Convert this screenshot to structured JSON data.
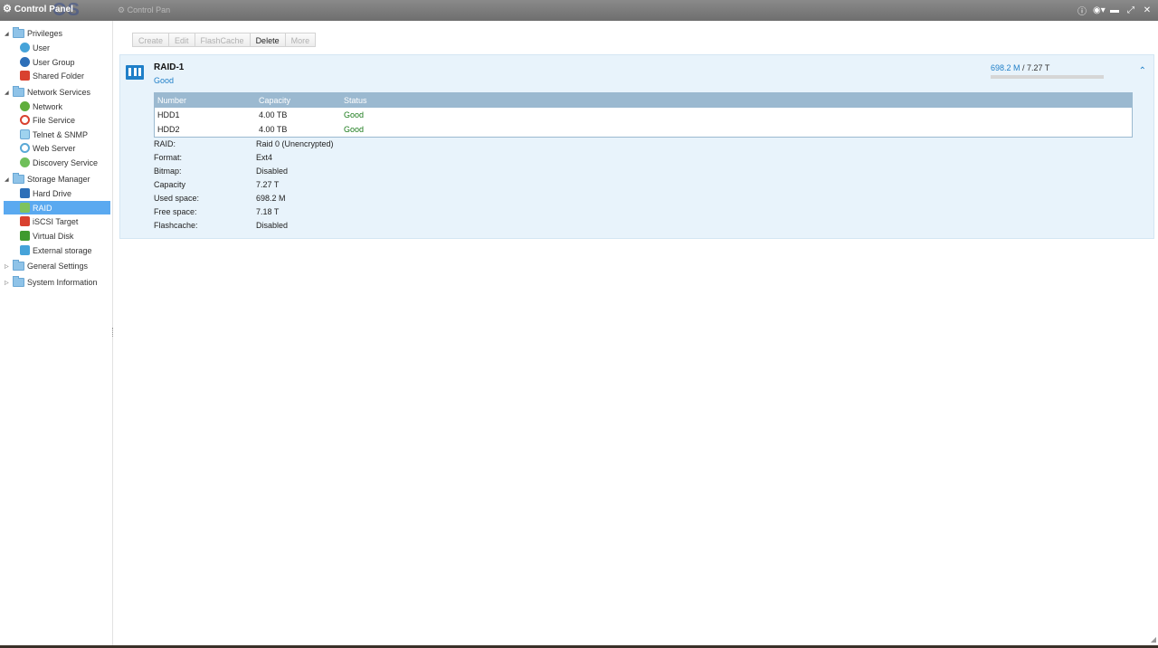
{
  "titlebar": {
    "title": "Control Panel",
    "logo_ghost": "OS",
    "tab_ghost": "Control Pan",
    "icons": [
      "info-icon",
      "globe-icon",
      "minimize-icon",
      "maximize-icon",
      "close-icon"
    ]
  },
  "sidebar": {
    "groups": [
      {
        "label": "Privileges",
        "expanded": true,
        "items": [
          "User",
          "User Group",
          "Shared Folder"
        ]
      },
      {
        "label": "Network Services",
        "expanded": true,
        "items": [
          "Network",
          "File Service",
          "Telnet & SNMP",
          "Web Server",
          "Discovery Service"
        ]
      },
      {
        "label": "Storage Manager",
        "expanded": true,
        "items": [
          "Hard Drive",
          "RAID",
          "iSCSI Target",
          "Virtual Disk",
          "External storage"
        ]
      },
      {
        "label": "General Settings",
        "expanded": false,
        "items": []
      },
      {
        "label": "System Information",
        "expanded": false,
        "items": []
      }
    ],
    "selected": "RAID"
  },
  "toolbar": {
    "create": "Create",
    "edit": "Edit",
    "flashcache": "FlashCache",
    "delete": "Delete",
    "more": "More"
  },
  "raid": {
    "name": "RAID-1",
    "status": "Good",
    "used": "698.2 M",
    "separator": " / ",
    "total": "7.27 T",
    "usage_fraction": 0.0001,
    "table": {
      "headers": [
        "Number",
        "Capacity",
        "Status"
      ],
      "rows": [
        {
          "number": "HDD1",
          "capacity": "4.00 TB",
          "status": "Good"
        },
        {
          "number": "HDD2",
          "capacity": "4.00 TB",
          "status": "Good"
        }
      ]
    },
    "properties": [
      {
        "key": "RAID:",
        "value": "Raid 0 (Unencrypted)"
      },
      {
        "key": "Format:",
        "value": "Ext4"
      },
      {
        "key": "Bitmap:",
        "value": "Disabled"
      },
      {
        "key": "Capacity",
        "value": "7.27 T"
      },
      {
        "key": "Used space:",
        "value": "698.2 M"
      },
      {
        "key": "Free space:",
        "value": "7.18 T"
      },
      {
        "key": "Flashcache:",
        "value": "Disabled"
      }
    ]
  },
  "colors": {
    "accent": "#1f7fc8",
    "selected_bg": "#5aa9f0",
    "panel_bg": "#e8f3fb",
    "table_header": "#9bb9d0",
    "good": "#1a7a1a"
  }
}
